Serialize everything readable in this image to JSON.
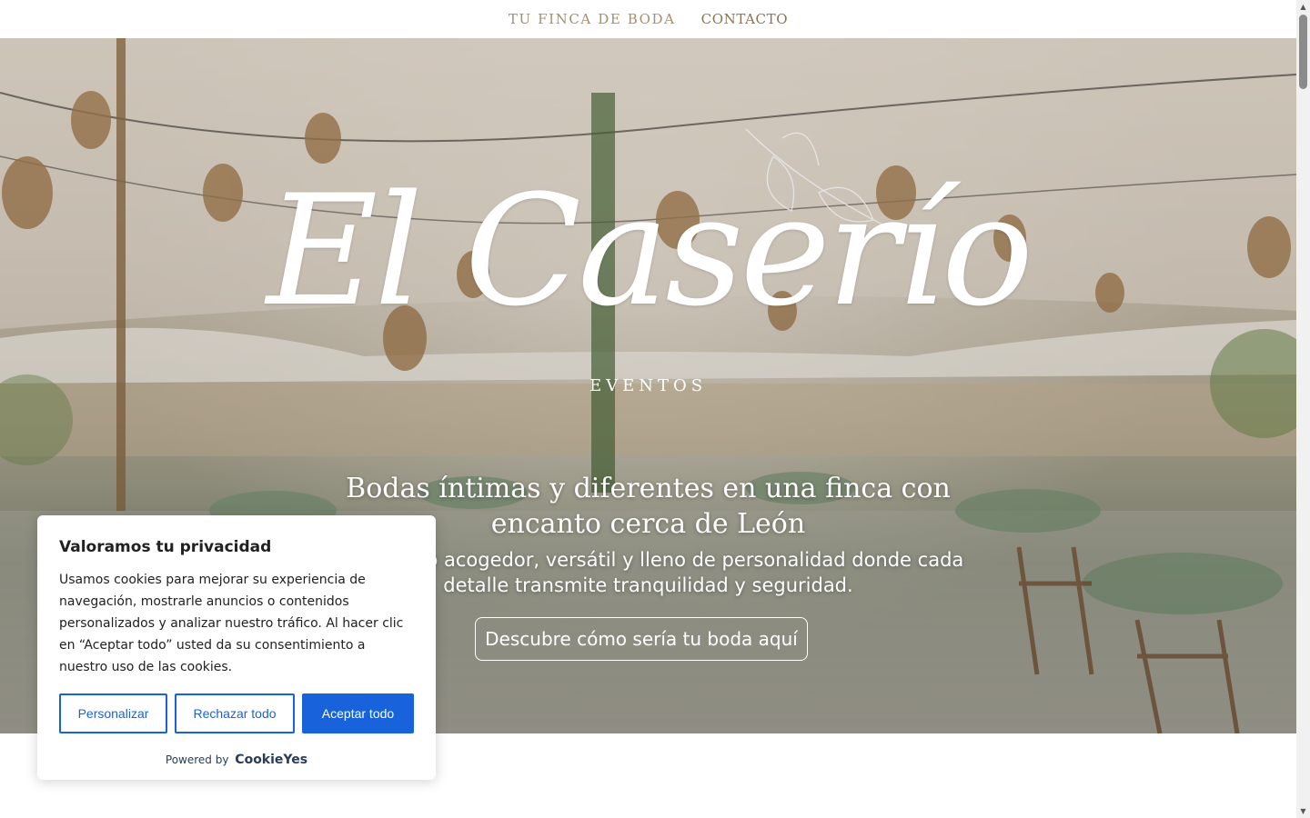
{
  "nav": {
    "items": [
      {
        "label": "TU FINCA DE BODA"
      },
      {
        "label": "CONTACTO"
      }
    ]
  },
  "hero": {
    "logo_script": "El Caserío",
    "logo_sub": "EVENTOS",
    "title": "Bodas íntimas y diferentes en una finca con encanto cerca de León",
    "description": "Un espacio acogedor, versátil y lleno de personalidad donde cada detalle transmite tranquilidad y seguridad.",
    "cta": "Descubre cómo sería tu boda aquí"
  },
  "cookie_banner": {
    "title": "Valoramos tu privacidad",
    "text": "Usamos cookies para mejorar su experiencia de navegación, mostrarle anuncios o contenidos personalizados y analizar nuestro tráfico. Al hacer clic en “Aceptar todo” usted da su consentimiento a nuestro uso de las cookies.",
    "customize_label": "Personalizar",
    "reject_label": "Rechazar todo",
    "accept_label": "Aceptar todo",
    "powered_by": "Powered by",
    "powered_brand": "CookieYes"
  },
  "colors": {
    "nav_text": "#a88e6e",
    "accent_blue": "#1863dc"
  }
}
